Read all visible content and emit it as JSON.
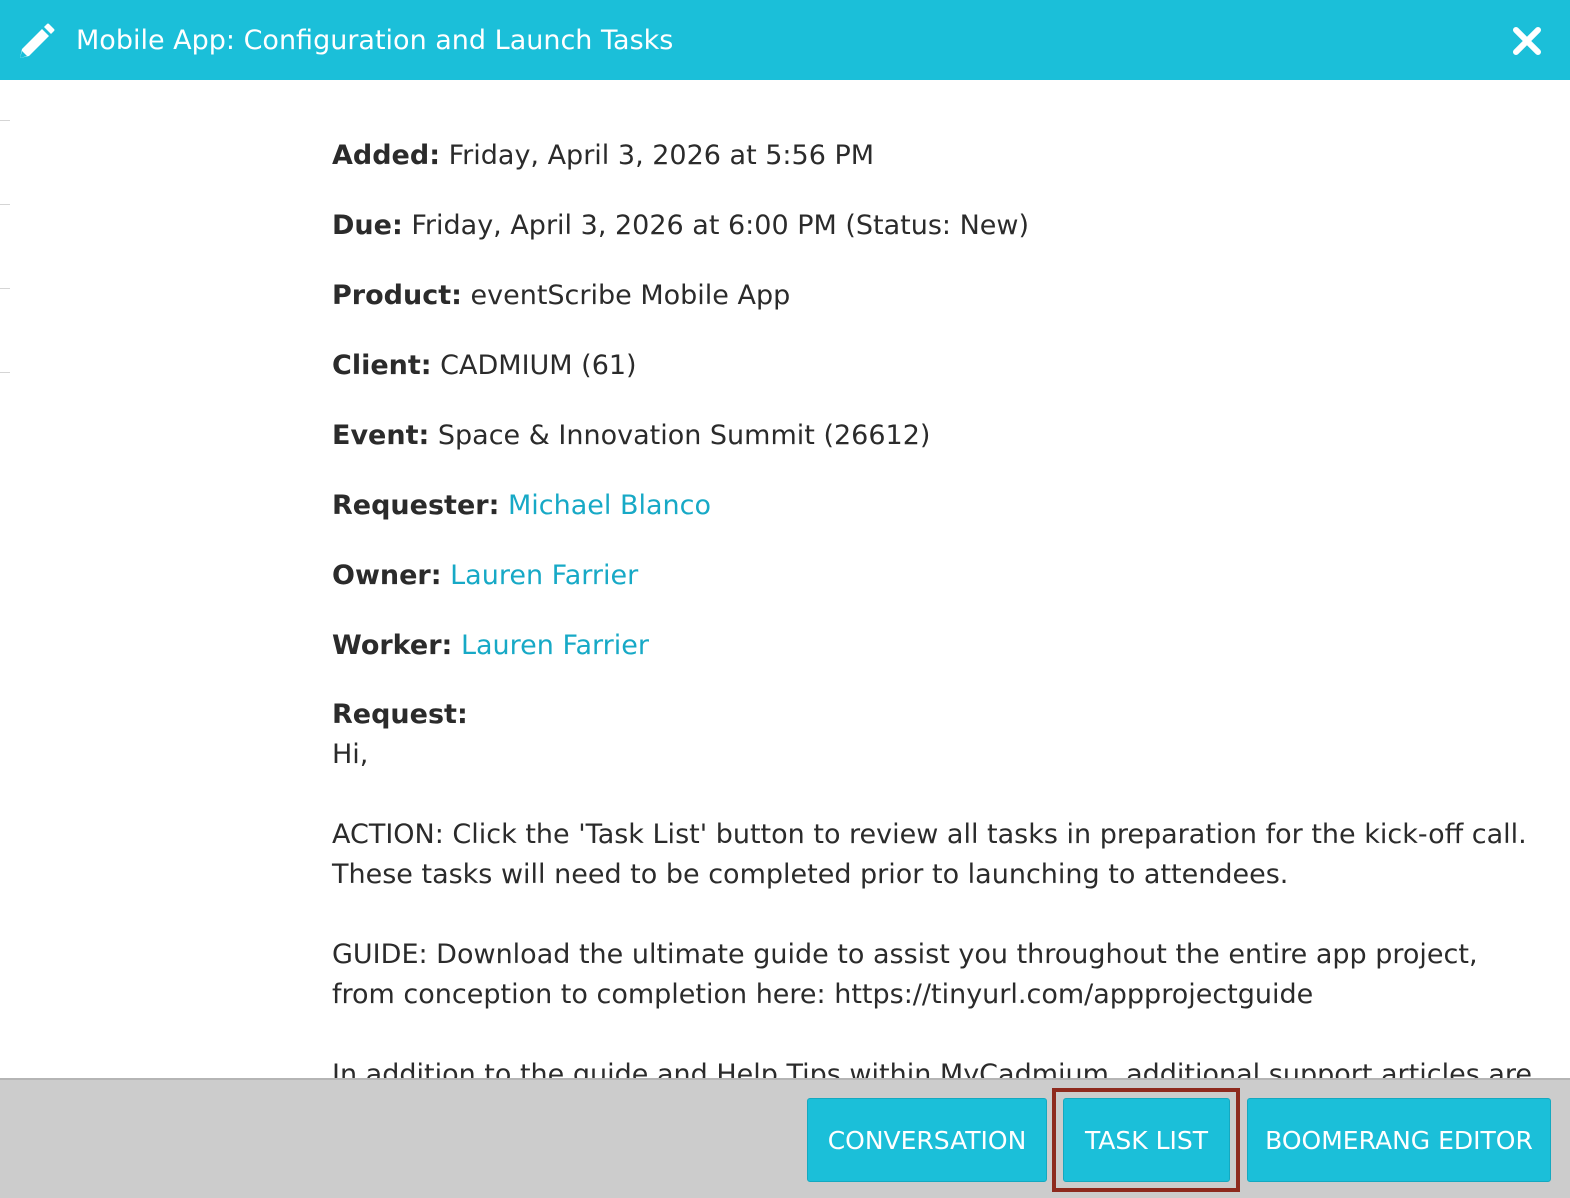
{
  "header": {
    "title": "Mobile App: Configuration and Launch Tasks",
    "edit_icon": "pencil-icon",
    "close_icon": "close-icon",
    "background_color": "#1bbfd9"
  },
  "details": {
    "added": {
      "label": "Added:",
      "value": "Friday, April 3, 2026 at 5:56 PM"
    },
    "due": {
      "label": "Due:",
      "value": "Friday, April 3, 2026 at 6:00 PM (Status: New)"
    },
    "product": {
      "label": "Product:",
      "value": "eventScribe Mobile App"
    },
    "client": {
      "label": "Client:",
      "value": "CADMIUM (61)"
    },
    "event": {
      "label": "Event:",
      "value": "Space & Innovation Summit (26612)"
    },
    "requester": {
      "label": "Requester:",
      "value": "Michael Blanco"
    },
    "owner": {
      "label": "Owner:",
      "value": "Lauren Farrier"
    },
    "worker": {
      "label": "Worker:",
      "value": "Lauren Farrier"
    }
  },
  "request": {
    "label": "Request:",
    "greeting": "Hi,",
    "action": "ACTION: Click the 'Task List' button to review all tasks in preparation for the kick-off call. These tasks will need to be completed prior to launching to attendees.",
    "guide": "GUIDE: Download the ultimate guide to assist you throughout the entire app project, from conception to completion here: https://tinyurl.com/appprojectguide",
    "additional": "In addition to the guide and Help Tips within MyCadmium, additional support articles are"
  },
  "footer": {
    "conversation_label": "CONVERSATION",
    "task_list_label": "TASK LIST",
    "boomerang_editor_label": "BOOMERANG EDITOR",
    "button_color": "#1bbfd9",
    "highlight_color": "#8e2a1e"
  }
}
